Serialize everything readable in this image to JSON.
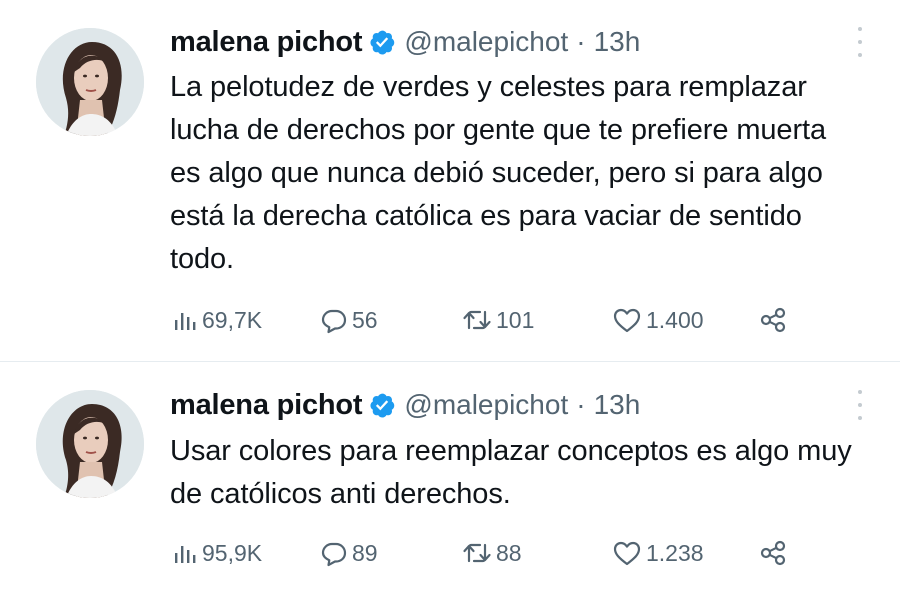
{
  "tweets": [
    {
      "name": "malena pichot",
      "handle": "@malepichot",
      "separator": "·",
      "time": "13h",
      "text": "La pelotudez de verdes y celestes para remplazar lucha de derechos por gente que te prefiere muerta es algo que nunca debió suceder, pero si para algo está la derecha católica es para vaciar de sentido todo.",
      "views": "69,7K",
      "replies": "56",
      "retweets": "101",
      "likes": "1.400"
    },
    {
      "name": "malena pichot",
      "handle": "@malepichot",
      "separator": "·",
      "time": "13h",
      "text": "Usar colores para reemplazar conceptos es algo muy de católicos anti derechos.",
      "views": "95,9K",
      "replies": "89",
      "retweets": "88",
      "likes": "1.238"
    }
  ],
  "icons": {
    "verified": "verified-badge-icon",
    "more": "more-vertical-icon",
    "views": "views-bar-chart-icon",
    "reply": "reply-bubble-icon",
    "retweet": "retweet-icon",
    "like": "heart-icon",
    "share": "share-icon"
  },
  "colors": {
    "text": "#0f1419",
    "secondary": "#536471",
    "verified": "#1d9bf0",
    "divider": "#e6ecf0"
  }
}
